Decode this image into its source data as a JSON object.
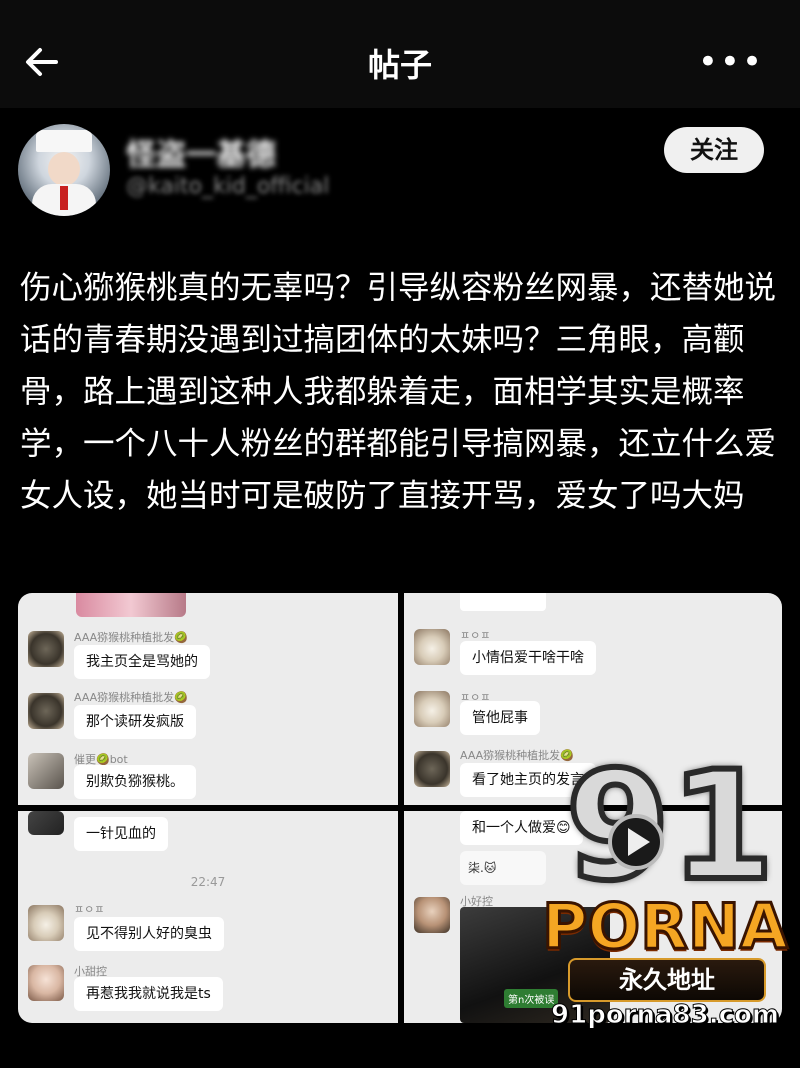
{
  "header": {
    "title": "帖子",
    "back_icon": "arrow-left-icon",
    "more_label": "•••"
  },
  "author": {
    "name": "怪盗一基德",
    "handle": "@kaito_kid_official",
    "follow_label": "关注"
  },
  "post": {
    "text": "伤心猕猴桃真的无辜吗？引导纵容粉丝网暴，还替她说话的青春期没遇到过搞团体的太妹吗？三角眼，高颧骨，路上遇到这种人我都躲着走，面相学其实是概率学，一个八十人粉丝的群都能引导搞网暴，还立什么爱女人设，她当时可是破防了直接开骂，爱女了吗大妈"
  },
  "screenshots": {
    "p1": [
      {
        "name": "AAA猕猴桃种植批发🥝",
        "text": "我主页全是骂她的"
      },
      {
        "name": "AAA猕猴桃种植批发🥝",
        "text": "那个读研发疯版"
      },
      {
        "name": "催更🥝bot",
        "text": "别欺负猕猴桃。"
      }
    ],
    "p2": [
      {
        "name": "ㅍㅇㅍ",
        "text": "小情侣爱干啥干啥"
      },
      {
        "name": "ㅍㅇㅍ",
        "text": "管他屁事"
      },
      {
        "name": "AAA猕猴桃种植批发🥝",
        "text": "看了她主页的发言"
      }
    ],
    "p3": {
      "first": "一针见血的",
      "time": "22:47",
      "msgs": [
        {
          "name": "ㅍㅇㅍ",
          "text": "见不得别人好的臭虫"
        },
        {
          "name": "小甜控",
          "text": "再惹我我就说我是ts"
        }
      ]
    },
    "p4": {
      "first": "和一个人做爱😊",
      "second": "柒.🐱",
      "name": "小好控",
      "thumb_label": "第n次被误"
    }
  },
  "watermark": {
    "number": "91",
    "brand": "PORNA",
    "ribbon": "永久地址",
    "url": "91porna83.com"
  }
}
